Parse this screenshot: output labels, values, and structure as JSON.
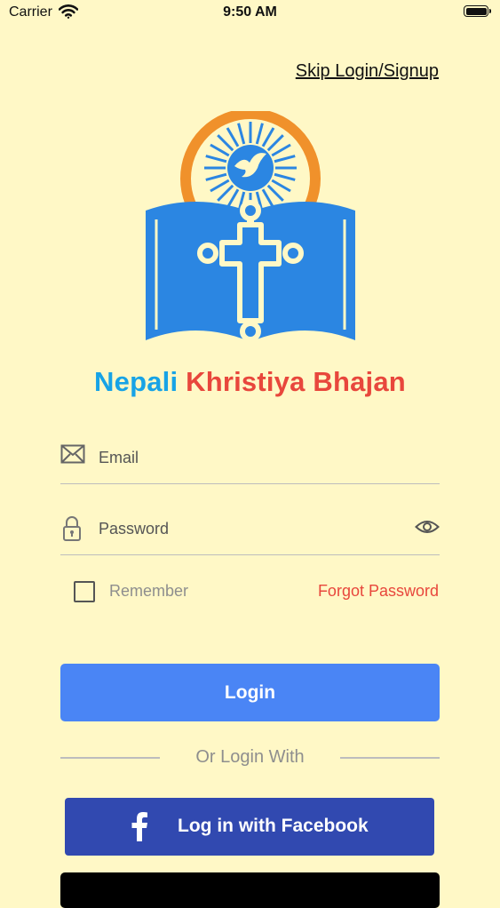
{
  "status_bar": {
    "carrier": "Carrier",
    "time": "9:50 AM"
  },
  "header": {
    "skip_label": "Skip Login/Signup"
  },
  "brand": {
    "title_part1": "Nepali",
    "title_part2": "Khristiya Bhajan",
    "color_blue": "#17A3E6",
    "color_red": "#E8473C",
    "logo_icon": "bible-cross-dove-icon"
  },
  "form": {
    "email_placeholder": "Email",
    "password_placeholder": "Password",
    "remember_label": "Remember",
    "forgot_label": "Forgot Password",
    "login_label": "Login",
    "or_label": "Or Login With",
    "facebook_label": "Log in with Facebook"
  },
  "colors": {
    "background": "#FFF8C6",
    "login_button": "#4A85F5",
    "facebook_button": "#3149B0",
    "accent_red": "#E8473C"
  }
}
